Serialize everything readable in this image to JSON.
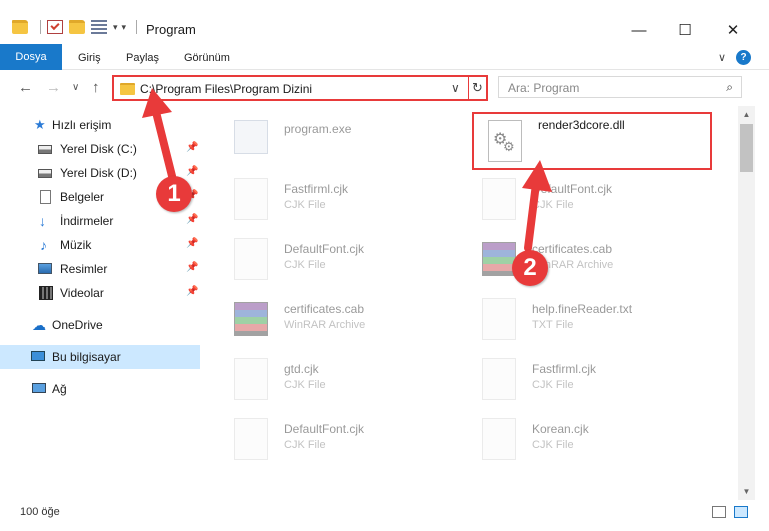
{
  "window": {
    "title": "Program",
    "minimize_glyph": "—",
    "maximize_glyph": "☐",
    "close_glyph": "✕"
  },
  "ribbon": {
    "tabs": [
      "Dosya",
      "Giriş",
      "Paylaş",
      "Görünüm"
    ],
    "collapse_glyph": "∨",
    "help_glyph": "?"
  },
  "nav": {
    "back_glyph": "←",
    "forward_glyph": "→",
    "recent_glyph": "∨",
    "up_glyph": "↑"
  },
  "address": {
    "path": "C:\\Program Files\\Program Dizini",
    "dropdown_glyph": "∨",
    "refresh_glyph": "↻"
  },
  "search": {
    "placeholder": "Ara: Program",
    "icon_glyph": "⌕"
  },
  "sidebar": {
    "items": [
      {
        "label": "Hızlı erişim",
        "icon": "star-icon"
      },
      {
        "label": "Yerel Disk (C:)",
        "icon": "drive-icon",
        "pinned": true
      },
      {
        "label": "Yerel Disk (D:)",
        "icon": "drive-icon",
        "pinned": true
      },
      {
        "label": "Belgeler",
        "icon": "documents-icon",
        "pinned": true
      },
      {
        "label": "İndirmeler",
        "icon": "downloads-icon",
        "pinned": true
      },
      {
        "label": "Müzik",
        "icon": "music-icon",
        "pinned": true
      },
      {
        "label": "Resimler",
        "icon": "pictures-icon",
        "pinned": true
      },
      {
        "label": "Videolar",
        "icon": "videos-icon",
        "pinned": true
      },
      {
        "label": "OneDrive",
        "icon": "onedrive-icon"
      },
      {
        "label": "Bu bilgisayar",
        "icon": "this-pc-icon",
        "selected": true
      },
      {
        "label": "Ağ",
        "icon": "network-icon"
      }
    ],
    "pin_glyph": "📌"
  },
  "files": [
    {
      "name": "program.exe",
      "type": "",
      "icon": "exe-icon"
    },
    {
      "name": "render3dcore.dll",
      "type": "",
      "icon": "dll-icon"
    },
    {
      "name": "Fastfirml.cjk",
      "type": "CJK File",
      "icon": "file-icon"
    },
    {
      "name": "DefaultFont.cjk",
      "type": "CJK File",
      "icon": "file-icon"
    },
    {
      "name": "DefaultFont.cjk",
      "type": "CJK File",
      "icon": "file-icon"
    },
    {
      "name": "certificates.cab",
      "type": "WinRAR Archive",
      "icon": "rar-icon"
    },
    {
      "name": "certificates.cab",
      "type": "WinRAR Archive",
      "icon": "rar-icon"
    },
    {
      "name": "help.fineReader.txt",
      "type": "TXT File",
      "icon": "file-icon"
    },
    {
      "name": "gtd.cjk",
      "type": "CJK File",
      "icon": "file-icon"
    },
    {
      "name": "Fastfirml.cjk",
      "type": "CJK File",
      "icon": "file-icon"
    },
    {
      "name": "DefaultFont.cjk",
      "type": "CJK File",
      "icon": "file-icon"
    },
    {
      "name": "Korean.cjk",
      "type": "CJK File",
      "icon": "file-icon"
    }
  ],
  "status": {
    "item_count": "100 öğe"
  },
  "annotations": {
    "step1": "1",
    "step2": "2",
    "accent_color": "#e83a3a"
  },
  "colors": {
    "ribbon_file_tab": "#1979ca",
    "selection": "#cce8ff"
  }
}
